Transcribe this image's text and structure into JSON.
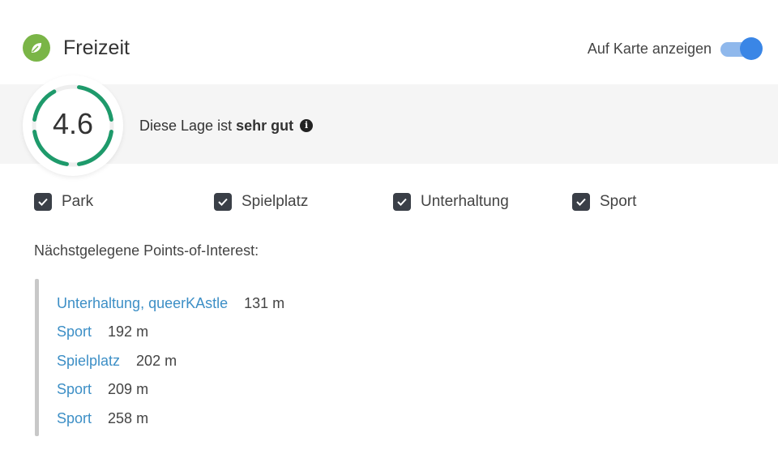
{
  "header": {
    "title": "Freizeit",
    "icon": "leaf-icon",
    "icon_color": "#7ab547",
    "toggle_label": "Auf Karte anzeigen",
    "toggle_on": true,
    "toggle_track_color": "#8fb8ec",
    "toggle_knob_color": "#3a86e6"
  },
  "rating": {
    "value": "4.6",
    "score": 4.6,
    "max": 5,
    "gauge_color": "#1e9a6b",
    "text": "Diese Lage ist",
    "text_bold": "sehr gut",
    "info_icon": "info-icon"
  },
  "filters": [
    {
      "label": "Park",
      "checked": true
    },
    {
      "label": "Spielplatz",
      "checked": true
    },
    {
      "label": "Unterhaltung",
      "checked": true
    },
    {
      "label": "Sport",
      "checked": true
    }
  ],
  "poi": {
    "heading": "Nächstgelegene Points-of-Interest:",
    "items": [
      {
        "name": "Unterhaltung, queerKAstle",
        "distance": "131 m"
      },
      {
        "name": "Sport",
        "distance": "192 m"
      },
      {
        "name": "Spielplatz",
        "distance": "202 m"
      },
      {
        "name": "Sport",
        "distance": "209 m"
      },
      {
        "name": "Sport",
        "distance": "258 m"
      }
    ],
    "link_color": "#3d8fc6"
  }
}
